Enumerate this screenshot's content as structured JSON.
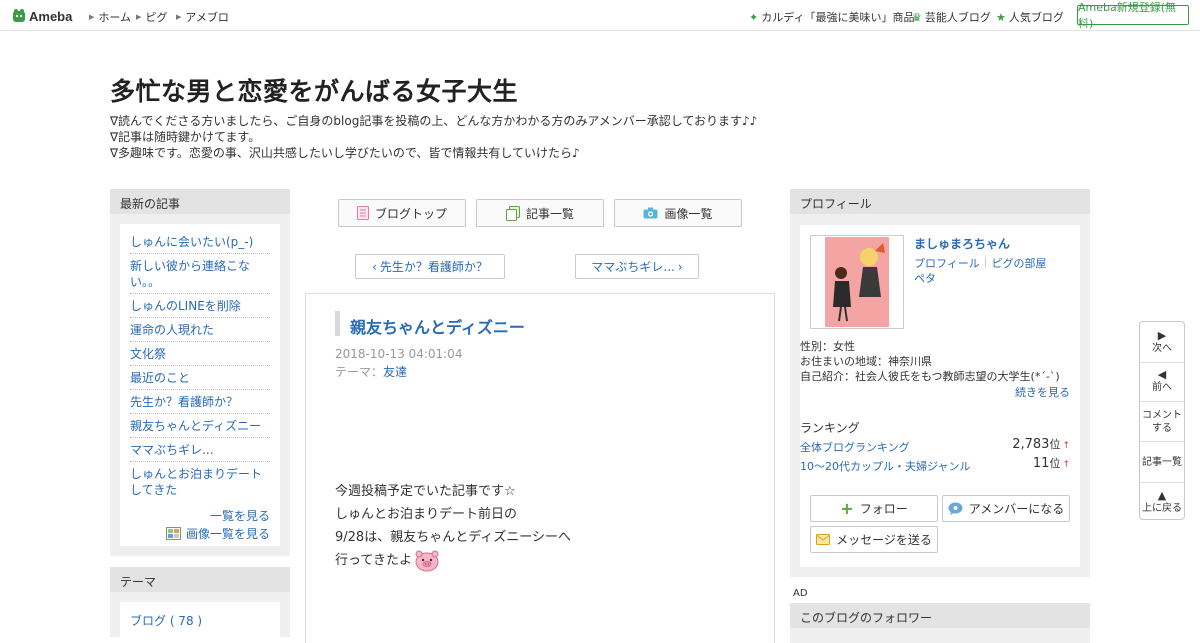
{
  "header": {
    "logo_text": "Ameba",
    "nav": [
      "ホーム",
      "ピグ",
      "アメブロ"
    ],
    "right_links": [
      "カルディ「最強に美味い」商品",
      "芸能人ブログ",
      "人気ブログ"
    ],
    "register_label": "Ameba新規登録(無料)"
  },
  "blog": {
    "title": "多忙な男と恋愛をがんばる女子大生",
    "desc": [
      "∇読んでくださる方いましたら、ご自身のblog記事を投稿の上、どんな方かわかる方のみアメンバー承認しております♪♪",
      "∇記事は随時鍵かけてます。",
      "∇多趣味です。恋愛の事、沢山共感したいし学びたいので、皆で情報共有していけたら♪"
    ]
  },
  "latest": {
    "heading": "最新の記事",
    "items": [
      "しゅんに会いたい(p_-)",
      "新しい彼から連絡こない。。",
      "しゅんのLINEを削除",
      "運命の人現れた",
      "文化祭",
      "最近のこと",
      "先生か？看護師か？",
      "親友ちゃんとディズニー",
      "ママぶちギレ...",
      "しゅんとお泊まりデートしてきた"
    ],
    "see_all": "一覧を見る",
    "see_images": "画像一覧を見る"
  },
  "theme": {
    "heading": "テーマ",
    "first_item": "ブログ ( 78 )"
  },
  "tabs": {
    "top": "ブログトップ",
    "list": "記事一覧",
    "images": "画像一覧"
  },
  "pager": {
    "prev": "先生か？看護師か？",
    "next": "ママぶちギレ..."
  },
  "article": {
    "title": "親友ちゃんとディズニー",
    "date": "2018-10-13 04:01:04",
    "theme_label": "テーマ：",
    "theme_value": "友達",
    "body": [
      "今週投稿予定でいた記事です☆",
      "しゅんとお泊まりデート前日の",
      "9/28は、親友ちゃんとディズニーシーへ",
      "行ってきたよ"
    ]
  },
  "profile": {
    "heading": "プロフィール",
    "name": "ましゅまろちゃん",
    "link_profile": "プロフィール",
    "link_pig": "ピグの部屋",
    "link_peta": "ペタ",
    "gender": "性別：女性",
    "location": "お住まいの地域：神奈川県",
    "intro": "自己紹介：社会人彼氏をもつ教師志望の大学生(*´-`)",
    "read_more": "続きを見る",
    "ranking_heading": "ランキング",
    "rank1_label": "全体ブログランキング",
    "rank1_value": "2,783",
    "rank2_label": "10〜20代カップル・夫婦ジャンル",
    "rank2_value": "11",
    "rank_unit": "位",
    "rank_arrow": "↑",
    "follow": "フォロー",
    "amember": "アメンバーになる",
    "message": "メッセージを送る"
  },
  "ad_label": "AD",
  "followers_heading": "このブログのフォロワー",
  "sidenav": {
    "next": "次へ",
    "prev": "前へ",
    "comment_1": "コメント",
    "comment_2": "する",
    "list": "記事一覧",
    "top": "上に戻る"
  },
  "colors": {
    "link": "#2a6bb5",
    "ameba_green": "#3a9b46",
    "panel_bg": "#efefef",
    "panel_head": "#e3e3e3"
  }
}
